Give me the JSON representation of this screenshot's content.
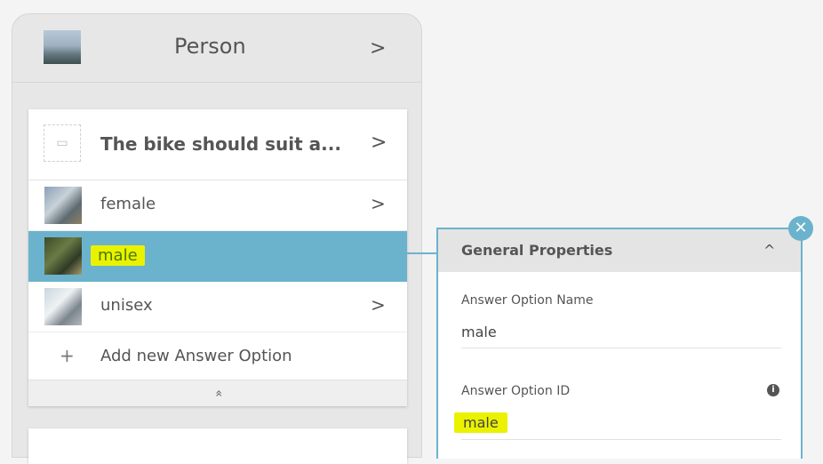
{
  "person": {
    "title": "Person",
    "chevron": ">"
  },
  "question": {
    "title": "The bike should suit a...",
    "chevron": ">"
  },
  "answers": [
    {
      "label": "female",
      "chevron": ">"
    },
    {
      "label": "male"
    },
    {
      "label": "unisex",
      "chevron": ">"
    }
  ],
  "add_answer": {
    "plus": "+",
    "label": "Add new Answer Option"
  },
  "collapse_icon": "«",
  "properties": {
    "title": "General Properties",
    "caret": "^",
    "close": "✕",
    "fields": [
      {
        "label": "Answer Option Name",
        "value": "male"
      },
      {
        "label": "Answer Option ID",
        "value": "male",
        "info": "i"
      }
    ]
  },
  "colors": {
    "accent": "#6bb3cd",
    "highlight": "#eaf200"
  }
}
